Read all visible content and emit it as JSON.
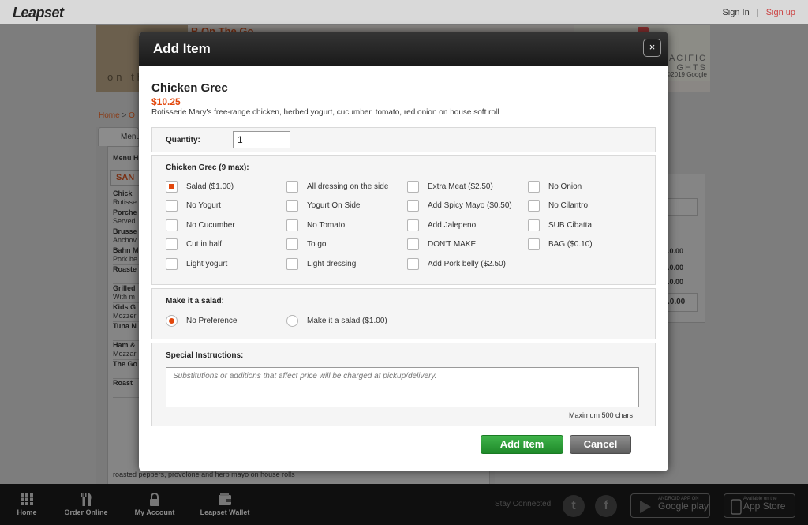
{
  "topbar": {
    "logo": "Leapset",
    "sign_in": "Sign In",
    "separator": "|",
    "sign_up": "Sign up"
  },
  "background": {
    "restaurant_name": "B On The Go",
    "thumb_text": "on th",
    "map_text": "PACIFIC\nGHTS",
    "map_copyright": "2019 Google",
    "breadcrumb_home": "Home",
    "breadcrumb_sep": ">",
    "breadcrumb_next": "O",
    "menu_tab": "Menu",
    "menu_header": "Menu H",
    "category": "SAN",
    "items": [
      {
        "name": "Chick",
        "desc": "Rotisse\non hou"
      },
      {
        "name": "Porche",
        "desc": "Served"
      },
      {
        "name": "Brusse",
        "desc": "Anchov"
      },
      {
        "name": "Bahn M",
        "desc": "Pork be"
      },
      {
        "name": "Roaste",
        "desc": ""
      },
      {
        "name": "Grilled",
        "desc": "With m"
      },
      {
        "name": "Kids G",
        "desc": "Mozzer"
      },
      {
        "name": "Tuna N",
        "desc": ""
      },
      {
        "name": "Ham &",
        "desc": "Mozzar"
      },
      {
        "name": "The Go",
        "desc": ""
      },
      {
        "name": "Roast",
        "desc": ""
      }
    ],
    "list_footer": "roasted peppers, provolone and herb mayo on house rolls",
    "right_values": [
      ".0.00",
      ".0.00",
      ".0.00",
      ".0.00"
    ]
  },
  "footer": {
    "nav": [
      {
        "label": "Home",
        "icon": "grid-icon"
      },
      {
        "label": "Order Online",
        "icon": "utensils-icon"
      },
      {
        "label": "My Account",
        "icon": "lock-icon"
      },
      {
        "label": "Leapset Wallet",
        "icon": "wallet-icon"
      }
    ],
    "stay_connected": "Stay Connected:",
    "twitter_icon": "twitter-icon",
    "facebook_icon": "facebook-icon",
    "google_play_small": "ANDROID APP ON",
    "google_play": "Google play",
    "app_store_small": "Available on the",
    "app_store": "App Store"
  },
  "modal": {
    "title": "Add Item",
    "close": "×",
    "item": {
      "name": "Chicken Grec",
      "price": "$10.25",
      "description": "Rotisserie Mary's free-range chicken, herbed yogurt, cucumber, tomato, red onion on house soft roll"
    },
    "quantity": {
      "label": "Quantity:",
      "value": "1"
    },
    "options_group": {
      "label": "Chicken Grec (9 max):",
      "options": [
        {
          "label": "Salad ($1.00)",
          "checked": true
        },
        {
          "label": "All dressing on the side",
          "checked": false
        },
        {
          "label": "Extra Meat ($2.50)",
          "checked": false
        },
        {
          "label": "No Onion",
          "checked": false
        },
        {
          "label": "No Yogurt",
          "checked": false
        },
        {
          "label": "Yogurt On Side",
          "checked": false
        },
        {
          "label": "Add Spicy Mayo ($0.50)",
          "checked": false
        },
        {
          "label": "No Cilantro",
          "checked": false
        },
        {
          "label": "No Cucumber",
          "checked": false
        },
        {
          "label": "No Tomato",
          "checked": false
        },
        {
          "label": "Add Jalepeno",
          "checked": false
        },
        {
          "label": "SUB Cibatta",
          "checked": false
        },
        {
          "label": "Cut in half",
          "checked": false
        },
        {
          "label": "To go",
          "checked": false
        },
        {
          "label": "DON'T MAKE",
          "checked": false
        },
        {
          "label": "BAG ($0.10)",
          "checked": false
        },
        {
          "label": "Light yogurt",
          "checked": false
        },
        {
          "label": "Light dressing",
          "checked": false
        },
        {
          "label": "Add Pork belly ($2.50)",
          "checked": false
        }
      ]
    },
    "salad_group": {
      "label": "Make it a salad:",
      "options": [
        {
          "label": "No Preference",
          "checked": true
        },
        {
          "label": "Make it a salad ($1.00)",
          "checked": false
        }
      ]
    },
    "special": {
      "label": "Special Instructions:",
      "placeholder": "Substitutions or additions that affect price will be charged at pickup/delivery.",
      "max_chars": "Maximum 500 chars"
    },
    "buttons": {
      "add": "Add Item",
      "cancel": "Cancel"
    }
  },
  "colors": {
    "accent": "#e2470c",
    "add_button": "#2ea13a",
    "cancel_button": "#777777",
    "header": "#222222"
  }
}
